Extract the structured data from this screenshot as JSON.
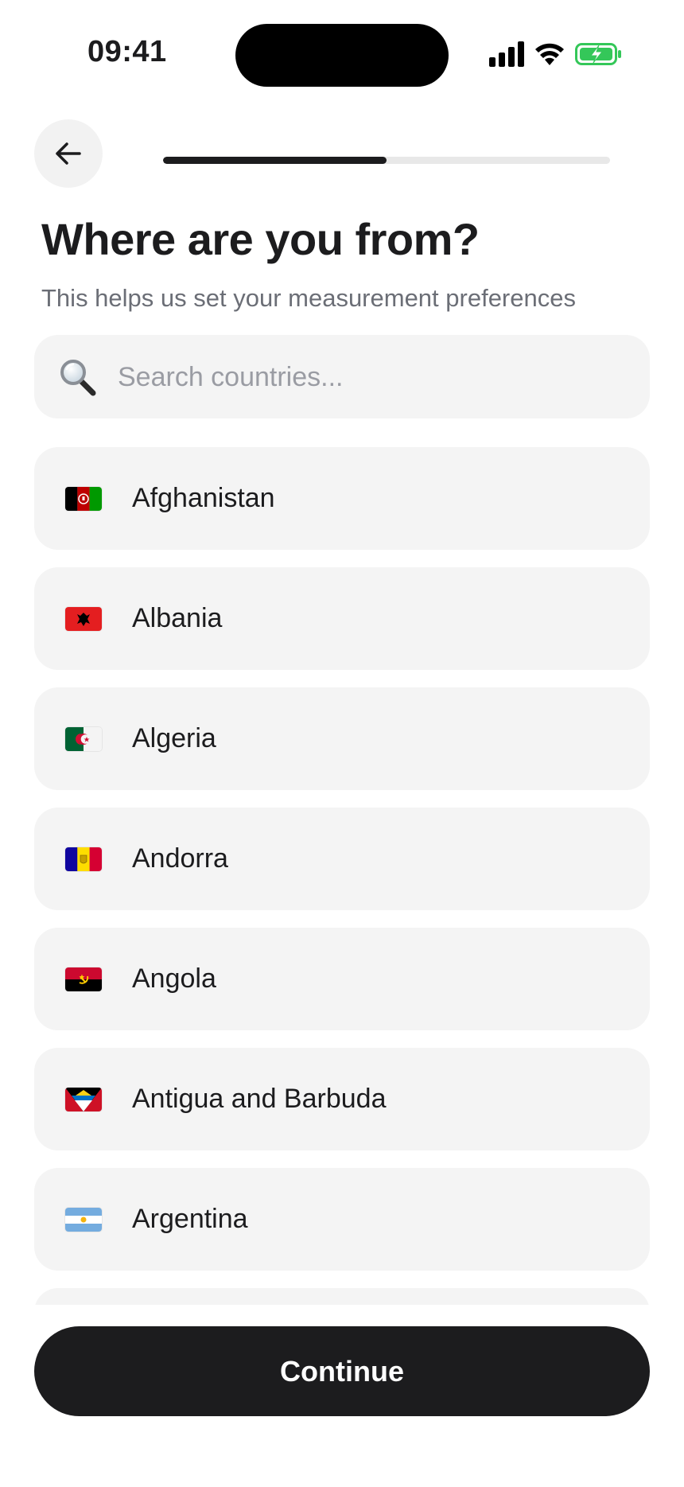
{
  "status_bar": {
    "time": "09:41",
    "icons": [
      "cellular-signal-icon",
      "wifi-icon",
      "battery-charging-icon"
    ],
    "battery_color": "#34c759"
  },
  "header": {
    "back_icon": "arrow-left-icon",
    "progress_fraction": 0.5
  },
  "title": "Where are you from?",
  "subtitle": "This helps us set your measurement preferences",
  "search": {
    "icon": "magnifying-glass-icon",
    "placeholder": "Search countries...",
    "value": ""
  },
  "countries": [
    {
      "name": "Afghanistan",
      "flag": "flag-afghanistan"
    },
    {
      "name": "Albania",
      "flag": "flag-albania"
    },
    {
      "name": "Algeria",
      "flag": "flag-algeria"
    },
    {
      "name": "Andorra",
      "flag": "flag-andorra"
    },
    {
      "name": "Angola",
      "flag": "flag-angola"
    },
    {
      "name": "Antigua and Barbuda",
      "flag": "flag-antigua-and-barbuda"
    },
    {
      "name": "Argentina",
      "flag": "flag-argentina"
    }
  ],
  "continue_label": "Continue",
  "colors": {
    "primary": "#1c1c1e",
    "surface": "#f4f4f4",
    "muted_text": "#6b6e76",
    "placeholder": "#9a9ca3"
  }
}
